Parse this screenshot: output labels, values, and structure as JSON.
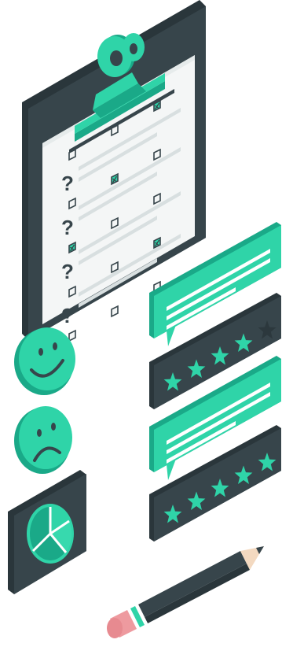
{
  "illustration": {
    "colors": {
      "dark": "#37454b",
      "dark_side": "#2a363b",
      "teal": "#2fd4a8",
      "teal_dark": "#1aa988",
      "paper": "#f4f6f6",
      "paper_line": "#d8dfe0",
      "pencil_tip": "#ee9a9f",
      "wood": "#f3d9c0"
    },
    "questionnaire": {
      "question_marks": [
        "?",
        "?",
        "?",
        "?"
      ],
      "answers": [
        [
          false,
          false,
          true
        ],
        [
          false,
          true,
          false
        ],
        [
          true,
          false,
          false
        ],
        [
          false,
          false,
          true
        ],
        [
          false,
          false,
          false
        ]
      ]
    },
    "icons": [
      "clipboard-icon",
      "happy-face-icon",
      "sad-face-icon",
      "pie-chart-icon",
      "speech-bubble-icon",
      "star-rating-icon",
      "pencil-icon"
    ],
    "ratings": [
      {
        "filled": 4,
        "total": 5
      },
      {
        "filled": 5,
        "total": 5
      }
    ]
  }
}
